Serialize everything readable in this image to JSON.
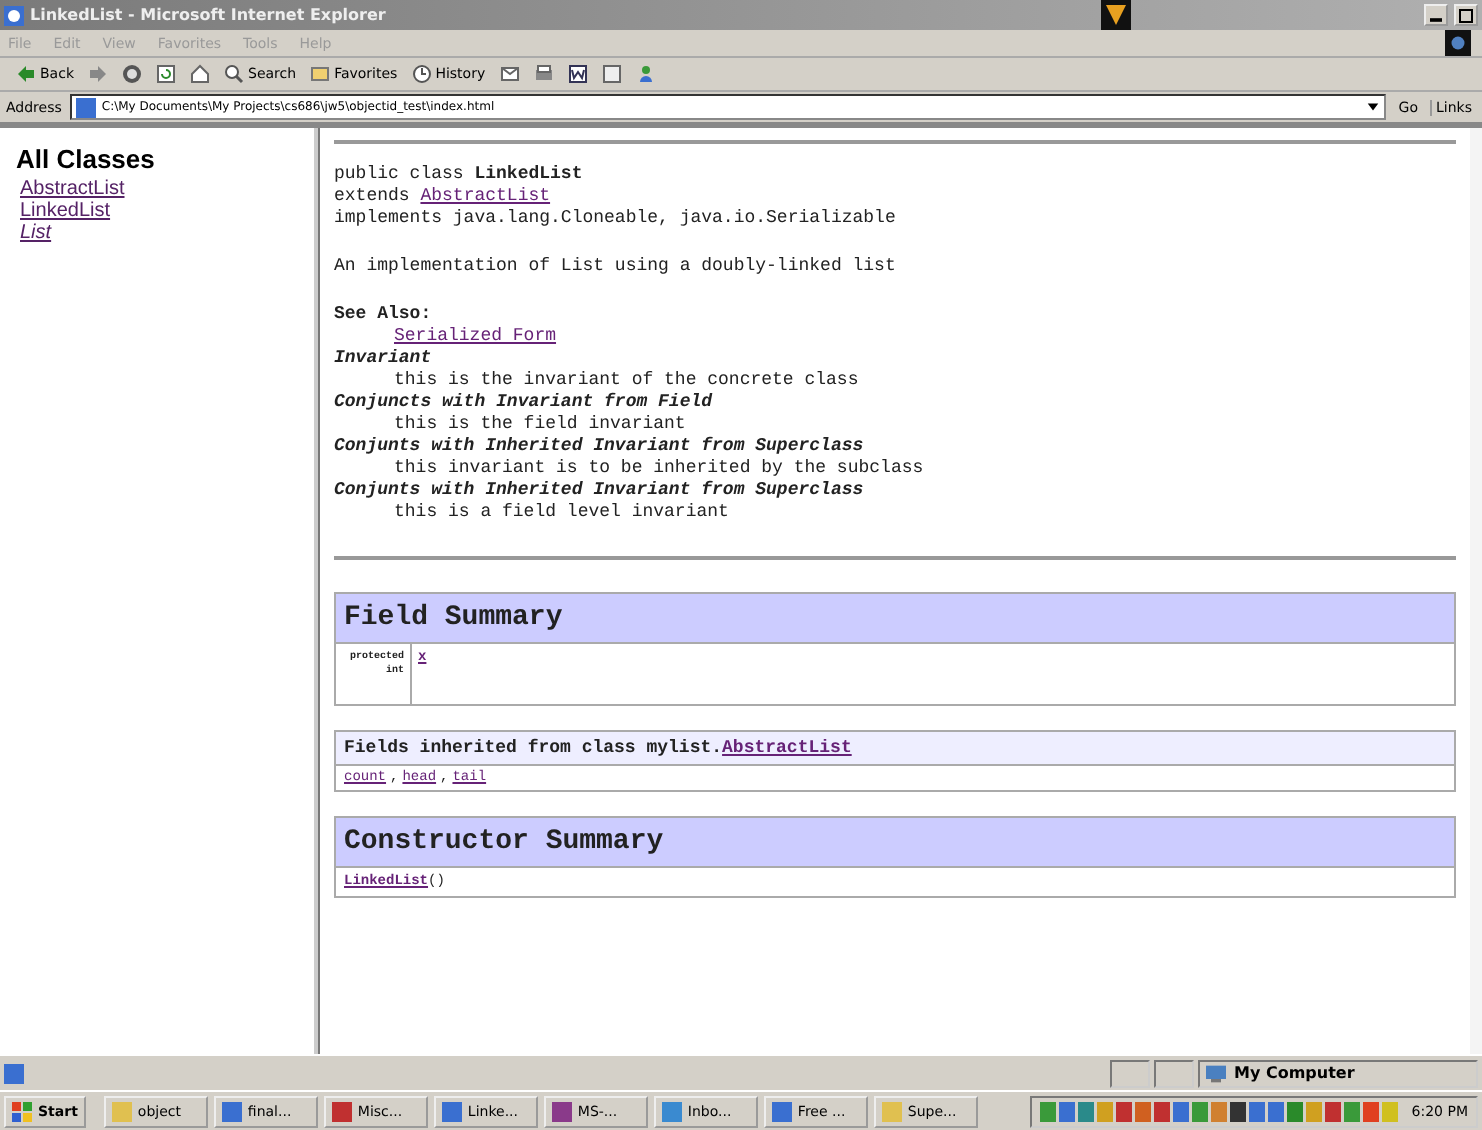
{
  "window": {
    "title": "LinkedList - Microsoft Internet Explorer"
  },
  "menu": [
    "File",
    "Edit",
    "View",
    "Favorites",
    "Tools",
    "Help"
  ],
  "toolbar": [
    {
      "kind": "back",
      "label": "Back"
    },
    {
      "kind": "forward"
    },
    {
      "kind": "stop"
    },
    {
      "kind": "refresh"
    },
    {
      "kind": "home"
    },
    {
      "kind": "search",
      "label": "Search"
    },
    {
      "kind": "favorites",
      "label": "Favorites"
    },
    {
      "kind": "history",
      "label": "History"
    },
    {
      "kind": "mail"
    },
    {
      "kind": "print"
    },
    {
      "kind": "edit"
    },
    {
      "kind": "discuss"
    },
    {
      "kind": "messenger"
    }
  ],
  "address": {
    "label": "Address",
    "value": "C:\\My Documents\\My Projects\\cs686\\jw5\\objectid_test\\index.html",
    "go": "Go",
    "links": "Links"
  },
  "sidebar": {
    "title": "All Classes",
    "items": [
      {
        "label": "AbstractList",
        "italic": false
      },
      {
        "label": "LinkedList",
        "italic": false
      },
      {
        "label": "List",
        "italic": true
      }
    ]
  },
  "doc": {
    "declaration": [
      {
        "kind": "plain",
        "text": "public class **LinkedList**"
      },
      {
        "kind": "extends",
        "text": "extends ",
        "link": "AbstractList"
      },
      {
        "kind": "plain",
        "text": "implements java.lang.Cloneable, java.io.Serializable"
      }
    ],
    "description": "An implementation of List using a doubly-linked list",
    "see_also": {
      "label": "See Also:",
      "link": "Serialized Form"
    },
    "tags": [
      {
        "heading": "Invariant",
        "text": "this is the invariant of the concrete class"
      },
      {
        "heading": "Conjuncts with Invariant from Field",
        "text": "this is the field invariant"
      },
      {
        "heading": "Conjunts with Inherited Invariant from Superclass",
        "text": "this invariant is to be inherited by the subclass"
      },
      {
        "heading": "Conjunts with Inherited Invariant from Superclass",
        "text": "this is a field level invariant"
      }
    ]
  },
  "field_summary": {
    "title": "Field Summary",
    "rows": [
      {
        "modifier": "protected int",
        "name": "x"
      }
    ]
  },
  "inherited": {
    "label": "Fields inherited from class mylist.",
    "link": "AbstractList",
    "separator": ",",
    "fields": [
      "count",
      "head",
      "tail"
    ]
  },
  "constructor_summary": {
    "title": "Constructor Summary",
    "rows": [
      {
        "name": "LinkedList",
        "args": "()"
      }
    ]
  },
  "status_bar": {
    "zone": "My Computer"
  },
  "taskbar": {
    "start": "Start",
    "tasks": [
      "object",
      "final...",
      "Misc...",
      "Linke...",
      "MS-...",
      "Inbo...",
      "Free ...",
      "Supe..."
    ],
    "clock": "6:20 PM"
  }
}
